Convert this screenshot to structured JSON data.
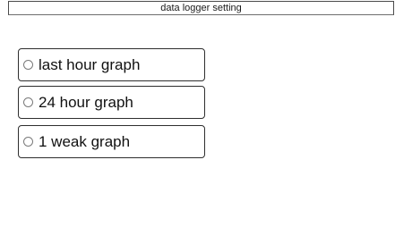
{
  "window": {
    "title": "data logger setting"
  },
  "options": [
    {
      "label": "last hour graph",
      "selected": false
    },
    {
      "label": "24 hour graph",
      "selected": false
    },
    {
      "label": "1 weak graph",
      "selected": false
    }
  ],
  "colors": {
    "background": "#ffffff",
    "border": "#2e2e2e",
    "radio_border": "#7a7a7a",
    "text": "#111111"
  }
}
